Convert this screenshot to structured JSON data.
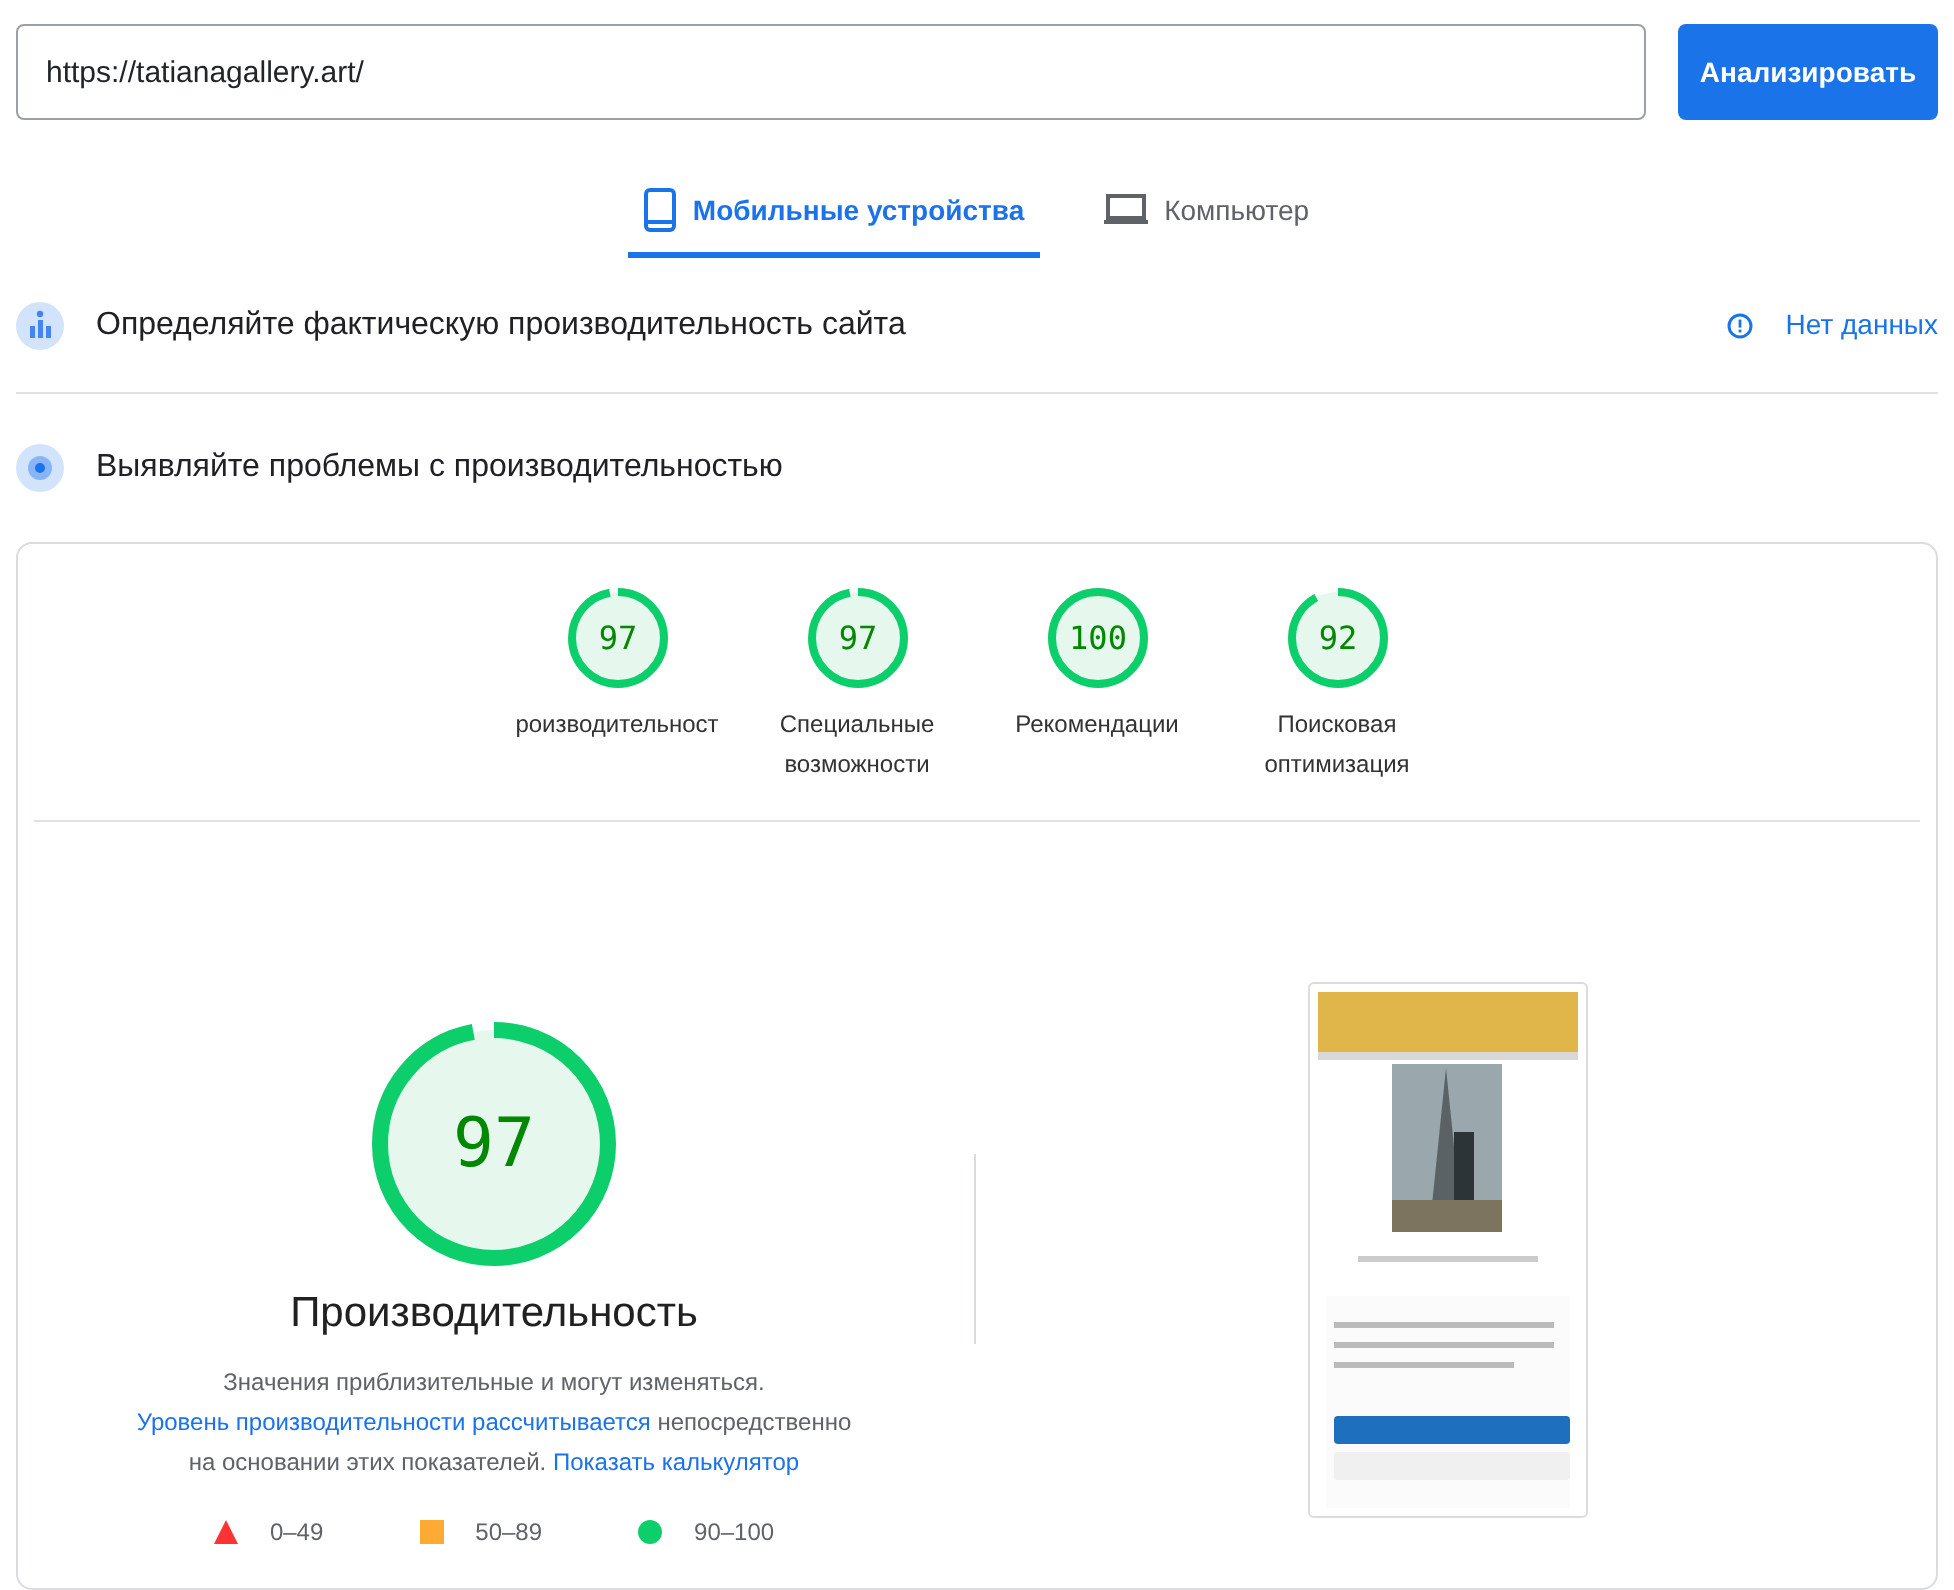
{
  "url_field": {
    "value": "https://tatianagallery.art/"
  },
  "analyze_button": "Анализировать",
  "device_tabs": [
    {
      "label": "Мобильные устройства",
      "kind": "mobile",
      "selected": true
    },
    {
      "label": "Компьютер",
      "kind": "desktop",
      "selected": false
    }
  ],
  "field_data": {
    "title": "Определяйте фактическую производительность сайта",
    "status": "Нет данных"
  },
  "lab_data": {
    "title": "Выявляйте проблемы с производительностью"
  },
  "category_scores": [
    {
      "score": "97",
      "label": "роизводительност"
    },
    {
      "score": "97",
      "label": "Специальные возможности"
    },
    {
      "score": "100",
      "label": "Рекомендации"
    },
    {
      "score": "92",
      "label": "Поисковая оптимизация"
    }
  ],
  "main_score": {
    "score": "97",
    "title": "Производительность"
  },
  "note": [
    {
      "text": "Значения приблизительные и могут изменяться. ",
      "kind": "text"
    },
    {
      "text": "Уровень производительности рассчитывается",
      "kind": "link"
    },
    {
      "text": " непосредственно на основании этих показателей. ",
      "kind": "text"
    },
    {
      "text": "Показать калькулятор",
      "kind": "link"
    }
  ],
  "legend": [
    {
      "kind": "triangle",
      "color": "#ff3333",
      "label": "0–49"
    },
    {
      "kind": "square",
      "color": "#ffaa33",
      "label": "50–89"
    },
    {
      "kind": "circle",
      "color": "#0cce6b",
      "label": "90–100"
    }
  ]
}
